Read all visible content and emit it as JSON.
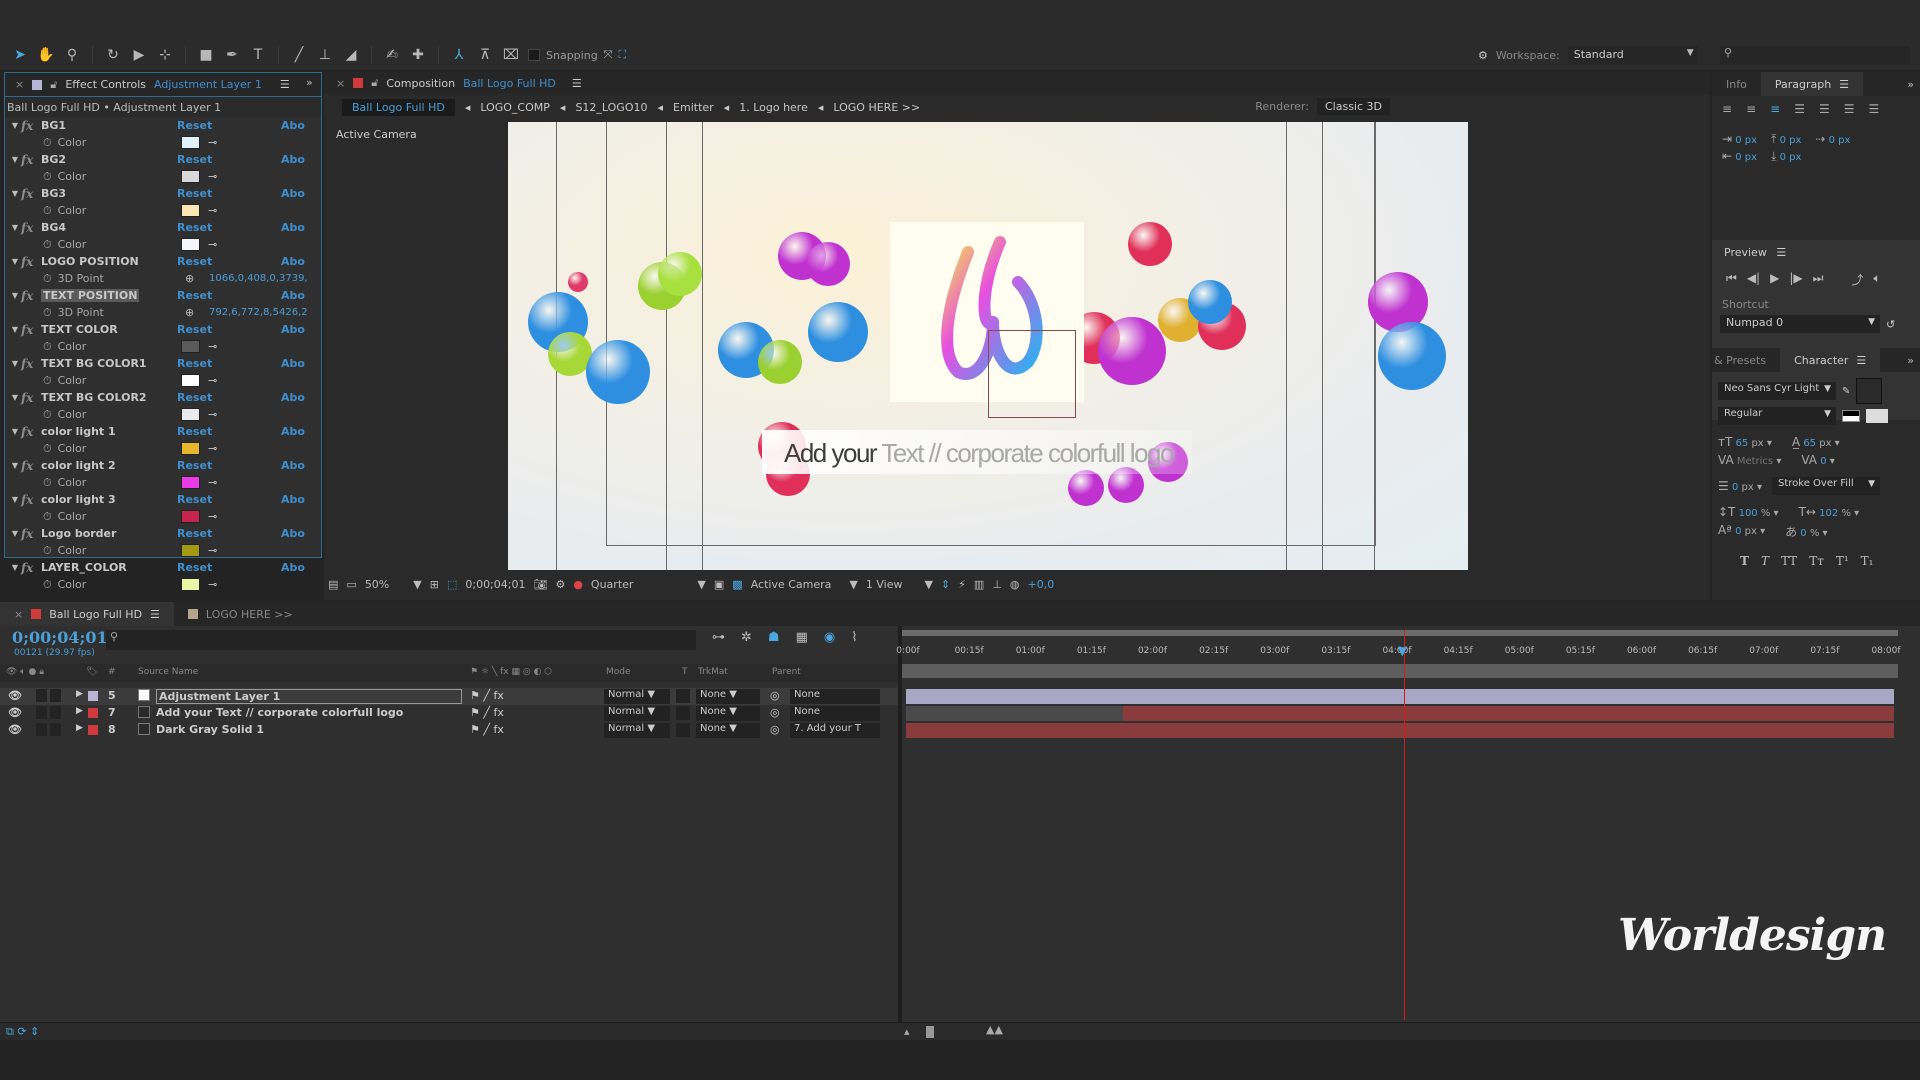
{
  "toolbar": {
    "tools": [
      "selection-tool",
      "hand-tool",
      "zoom-tool",
      "rotate-tool",
      "camera-tool",
      "pan-behind-tool",
      "rectangle-tool",
      "pen-tool",
      "type-tool",
      "brush-tool",
      "clone-stamp-tool",
      "eraser-tool",
      "roto-brush-tool",
      "puppet-pin-tool",
      "axis-local",
      "axis-world",
      "axis-view"
    ],
    "snapping_label": "Snapping",
    "workspace_label": "Workspace:",
    "workspace_value": "Standard"
  },
  "effect_controls": {
    "tab_label": "Effect Controls",
    "tab_layer": "Adjustment Layer 1",
    "subtitle": "Ball Logo Full HD • Adjustment Layer 1",
    "reset_label": "Reset",
    "about_label": "Abo",
    "effects": [
      {
        "name": "BG1",
        "prop": "Color",
        "type": "color",
        "value": "#dff1fb"
      },
      {
        "name": "BG2",
        "prop": "Color",
        "type": "color",
        "value": "#d8d8d8"
      },
      {
        "name": "BG3",
        "prop": "Color",
        "type": "color",
        "value": "#fbe7b4"
      },
      {
        "name": "BG4",
        "prop": "Color",
        "type": "color",
        "value": "#f4f6fb"
      },
      {
        "name": "LOGO POSITION",
        "prop": "3D Point",
        "type": "point",
        "value": "1066,0,408,0,3739,"
      },
      {
        "name": "TEXT POSITION",
        "prop": "3D Point",
        "type": "point",
        "value": "792,6,772,8,5426,2",
        "selected": true
      },
      {
        "name": "TEXT COLOR",
        "prop": "Color",
        "type": "color",
        "value": "#5a5a5a"
      },
      {
        "name": "TEXT BG COLOR1",
        "prop": "Color",
        "type": "color",
        "value": "#ffffff"
      },
      {
        "name": "TEXT BG COLOR2",
        "prop": "Color",
        "type": "color",
        "value": "#eaeaea"
      },
      {
        "name": "color light 1",
        "prop": "Color",
        "type": "color",
        "value": "#e6b62d"
      },
      {
        "name": "color light 2",
        "prop": "Color",
        "type": "color",
        "value": "#e63be6"
      },
      {
        "name": "color light 3",
        "prop": "Color",
        "type": "color",
        "value": "#c7234f"
      },
      {
        "name": "Logo border",
        "prop": "Color",
        "type": "color",
        "value": "#a39a14"
      },
      {
        "name": "LAYER_COLOR",
        "prop": "Color",
        "type": "color",
        "value": "#e9f7a6"
      }
    ]
  },
  "composition": {
    "tab_label": "Composition",
    "tab_comp": "Ball Logo Full HD",
    "breadcrumbs": [
      "Ball Logo Full HD",
      "LOGO_COMP",
      "S12_LOGO10",
      "Emitter",
      "1. Logo here",
      "LOGO HERE >>"
    ],
    "renderer_label": "Renderer:",
    "renderer_value": "Classic 3D",
    "view_label": "Active Camera",
    "preview_text_dark": "Add your",
    "preview_text_light": "Text  // corporate colorfull logo",
    "viewer_bar": {
      "zoom": "50%",
      "timecode": "0;00;04;01",
      "resolution": "Quarter",
      "camera": "Active Camera",
      "views": "1 View",
      "exposure": "+0,0"
    }
  },
  "paragraph": {
    "tabs": [
      "Info",
      "Paragraph"
    ],
    "active_tab": "Paragraph",
    "indent_left": "0 px",
    "space_before": "0 px",
    "indent_first": "0 px",
    "indent_right": "0 px",
    "space_after": "0 px"
  },
  "preview": {
    "title": "Preview",
    "shortcut_label": "Shortcut",
    "shortcut_value": "Numpad 0"
  },
  "character": {
    "tabs": [
      "& Presets",
      "Character"
    ],
    "active_tab": "Character",
    "font": "Neo Sans Cyr Light",
    "style": "Regular",
    "font_size": "65",
    "leading": "65",
    "unit_px": "px",
    "kerning": "Metrics",
    "tracking": "0",
    "stroke_width": "0",
    "stroke_mode": "Stroke Over Fill",
    "vscale": "100",
    "hscale": "102",
    "baseline": "0",
    "tsume": "0",
    "pct": "%"
  },
  "timeline": {
    "tabs": [
      {
        "label": "Ball Logo Full HD",
        "color": "#d03a3a",
        "active": true
      },
      {
        "label": "LOGO HERE >>",
        "color": "#b5a58a",
        "active": false
      }
    ],
    "timecode": "0;00;04;01",
    "frames": "00121 (29.97 fps)",
    "columns": {
      "num": "#",
      "source": "Source Name",
      "mode": "Mode",
      "t": "T",
      "trkmat": "TrkMat",
      "parent": "Parent"
    },
    "layers": [
      {
        "num": "5",
        "name": "Adjustment Layer 1",
        "label_color": "#b7b4d6",
        "mode": "Normal",
        "trkmat": "None",
        "parent": "None",
        "bar_color": "#a9a7c6",
        "bar_start": 0.0,
        "selected": true
      },
      {
        "num": "7",
        "name": "Add your Text  // corporate colorfull logo",
        "label_color": "#d03a3a",
        "mode": "Normal",
        "trkmat": "None",
        "parent": "None",
        "bar_color": "#8a3c3c",
        "bar_start": 0.22
      },
      {
        "num": "8",
        "name": "Dark Gray Solid 1",
        "label_color": "#d03a3a",
        "mode": "Normal",
        "trkmat": "None",
        "parent": "7. Add your T",
        "bar_color": "#8a3c3c",
        "bar_start": 0.0
      }
    ],
    "ruler_ticks": [
      "0:00f",
      "00:15f",
      "01:00f",
      "01:15f",
      "02:00f",
      "02:15f",
      "03:00f",
      "03:15f",
      "04:00f",
      "04:15f",
      "05:00f",
      "05:15f",
      "06:00f",
      "06:15f",
      "07:00f",
      "07:15f",
      "08:00f"
    ],
    "playhead_seconds": 4.03,
    "duration_seconds": 8
  },
  "watermark": "Worldesign"
}
